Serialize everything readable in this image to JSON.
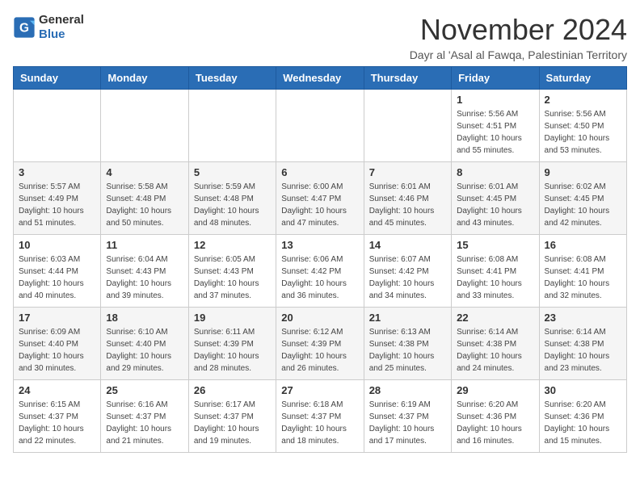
{
  "logo": {
    "line1": "General",
    "line2": "Blue"
  },
  "title": "November 2024",
  "subtitle": "Dayr al 'Asal al Fawqa, Palestinian Territory",
  "headers": [
    "Sunday",
    "Monday",
    "Tuesday",
    "Wednesday",
    "Thursday",
    "Friday",
    "Saturday"
  ],
  "weeks": [
    [
      {
        "day": "",
        "info": ""
      },
      {
        "day": "",
        "info": ""
      },
      {
        "day": "",
        "info": ""
      },
      {
        "day": "",
        "info": ""
      },
      {
        "day": "",
        "info": ""
      },
      {
        "day": "1",
        "info": "Sunrise: 5:56 AM\nSunset: 4:51 PM\nDaylight: 10 hours\nand 55 minutes."
      },
      {
        "day": "2",
        "info": "Sunrise: 5:56 AM\nSunset: 4:50 PM\nDaylight: 10 hours\nand 53 minutes."
      }
    ],
    [
      {
        "day": "3",
        "info": "Sunrise: 5:57 AM\nSunset: 4:49 PM\nDaylight: 10 hours\nand 51 minutes."
      },
      {
        "day": "4",
        "info": "Sunrise: 5:58 AM\nSunset: 4:48 PM\nDaylight: 10 hours\nand 50 minutes."
      },
      {
        "day": "5",
        "info": "Sunrise: 5:59 AM\nSunset: 4:48 PM\nDaylight: 10 hours\nand 48 minutes."
      },
      {
        "day": "6",
        "info": "Sunrise: 6:00 AM\nSunset: 4:47 PM\nDaylight: 10 hours\nand 47 minutes."
      },
      {
        "day": "7",
        "info": "Sunrise: 6:01 AM\nSunset: 4:46 PM\nDaylight: 10 hours\nand 45 minutes."
      },
      {
        "day": "8",
        "info": "Sunrise: 6:01 AM\nSunset: 4:45 PM\nDaylight: 10 hours\nand 43 minutes."
      },
      {
        "day": "9",
        "info": "Sunrise: 6:02 AM\nSunset: 4:45 PM\nDaylight: 10 hours\nand 42 minutes."
      }
    ],
    [
      {
        "day": "10",
        "info": "Sunrise: 6:03 AM\nSunset: 4:44 PM\nDaylight: 10 hours\nand 40 minutes."
      },
      {
        "day": "11",
        "info": "Sunrise: 6:04 AM\nSunset: 4:43 PM\nDaylight: 10 hours\nand 39 minutes."
      },
      {
        "day": "12",
        "info": "Sunrise: 6:05 AM\nSunset: 4:43 PM\nDaylight: 10 hours\nand 37 minutes."
      },
      {
        "day": "13",
        "info": "Sunrise: 6:06 AM\nSunset: 4:42 PM\nDaylight: 10 hours\nand 36 minutes."
      },
      {
        "day": "14",
        "info": "Sunrise: 6:07 AM\nSunset: 4:42 PM\nDaylight: 10 hours\nand 34 minutes."
      },
      {
        "day": "15",
        "info": "Sunrise: 6:08 AM\nSunset: 4:41 PM\nDaylight: 10 hours\nand 33 minutes."
      },
      {
        "day": "16",
        "info": "Sunrise: 6:08 AM\nSunset: 4:41 PM\nDaylight: 10 hours\nand 32 minutes."
      }
    ],
    [
      {
        "day": "17",
        "info": "Sunrise: 6:09 AM\nSunset: 4:40 PM\nDaylight: 10 hours\nand 30 minutes."
      },
      {
        "day": "18",
        "info": "Sunrise: 6:10 AM\nSunset: 4:40 PM\nDaylight: 10 hours\nand 29 minutes."
      },
      {
        "day": "19",
        "info": "Sunrise: 6:11 AM\nSunset: 4:39 PM\nDaylight: 10 hours\nand 28 minutes."
      },
      {
        "day": "20",
        "info": "Sunrise: 6:12 AM\nSunset: 4:39 PM\nDaylight: 10 hours\nand 26 minutes."
      },
      {
        "day": "21",
        "info": "Sunrise: 6:13 AM\nSunset: 4:38 PM\nDaylight: 10 hours\nand 25 minutes."
      },
      {
        "day": "22",
        "info": "Sunrise: 6:14 AM\nSunset: 4:38 PM\nDaylight: 10 hours\nand 24 minutes."
      },
      {
        "day": "23",
        "info": "Sunrise: 6:14 AM\nSunset: 4:38 PM\nDaylight: 10 hours\nand 23 minutes."
      }
    ],
    [
      {
        "day": "24",
        "info": "Sunrise: 6:15 AM\nSunset: 4:37 PM\nDaylight: 10 hours\nand 22 minutes."
      },
      {
        "day": "25",
        "info": "Sunrise: 6:16 AM\nSunset: 4:37 PM\nDaylight: 10 hours\nand 21 minutes."
      },
      {
        "day": "26",
        "info": "Sunrise: 6:17 AM\nSunset: 4:37 PM\nDaylight: 10 hours\nand 19 minutes."
      },
      {
        "day": "27",
        "info": "Sunrise: 6:18 AM\nSunset: 4:37 PM\nDaylight: 10 hours\nand 18 minutes."
      },
      {
        "day": "28",
        "info": "Sunrise: 6:19 AM\nSunset: 4:37 PM\nDaylight: 10 hours\nand 17 minutes."
      },
      {
        "day": "29",
        "info": "Sunrise: 6:20 AM\nSunset: 4:36 PM\nDaylight: 10 hours\nand 16 minutes."
      },
      {
        "day": "30",
        "info": "Sunrise: 6:20 AM\nSunset: 4:36 PM\nDaylight: 10 hours\nand 15 minutes."
      }
    ]
  ]
}
